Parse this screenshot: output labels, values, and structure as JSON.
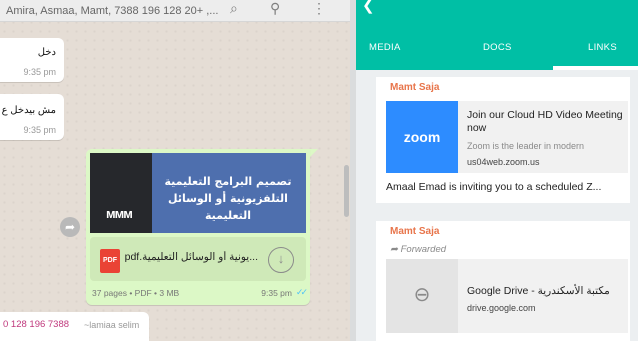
{
  "chat": {
    "header": {
      "participants": "Amira, Asmaa, Mamt, 7388 196 128 20+ ,..."
    },
    "messages": [
      {
        "text": "دخل",
        "time": "9:35 pm"
      },
      {
        "text": "مش بيدخل ع",
        "time": "9:35 pm"
      }
    ],
    "document": {
      "thumbnail_title": "تصميم البرامج التعليمية التلفزيونية أو الوسائل التعليمية",
      "file_type": "PDF",
      "file_name": "...يونية أو الوسائل التعليمية.pdf",
      "meta": "37 pages • PDF • 3 MB",
      "time": "9:35 pm"
    },
    "last_message": {
      "phone": "0 128 196 7388",
      "name": "~lamiaa selim"
    }
  },
  "panel": {
    "tabs": [
      "MEDIA",
      "DOCS",
      "LINKS"
    ],
    "active_tab": "LINKS",
    "links": [
      {
        "sender": "Mamt Saja",
        "forwarded": "",
        "logo": "zoom",
        "title": "Join our Cloud HD Video Meeting now",
        "description": "Zoom is the leader in modern",
        "domain": "us04web.zoom.us",
        "caption": "Amaal Emad is inviting you to a scheduled Z..."
      },
      {
        "sender": "Mamt Saja",
        "forwarded": "Forwarded",
        "logo": "link-icon",
        "title": "Google Drive - مكتبة الأسكندرية",
        "domain": "drive.google.com"
      }
    ]
  },
  "colors": {
    "accent": "#00bfa5",
    "outgoing_bubble": "#dcf8c6",
    "sender_name": "#e8754b",
    "phone_name": "#c0397d",
    "read_ticks": "#4fc3f7",
    "zoom_blue": "#2d8cff"
  }
}
